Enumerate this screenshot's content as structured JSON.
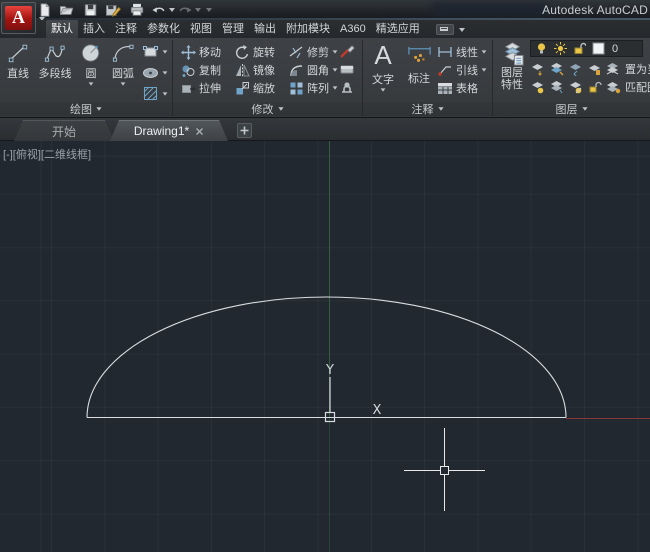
{
  "title_bar": {
    "app_title": "Autodesk AutoCAD"
  },
  "ribbon": {
    "tabs": [
      "默认",
      "插入",
      "注释",
      "参数化",
      "视图",
      "管理",
      "输出",
      "附加模块",
      "A360",
      "精选应用"
    ],
    "active_tab": "默认",
    "draw_panel": {
      "title": "绘图",
      "line": "直线",
      "polyline": "多段线",
      "circle": "圆",
      "arc": "圆弧"
    },
    "modify_panel": {
      "title": "修改",
      "move": "移动",
      "rotate": "旋转",
      "trim": "修剪",
      "copy": "复制",
      "mirror": "镜像",
      "fillet": "圆角",
      "stretch": "拉伸",
      "scale": "缩放",
      "array": "阵列"
    },
    "annotation_panel": {
      "title": "注释",
      "text": "文字",
      "text_icon": "A",
      "dimension": "标注",
      "linear": "线性",
      "leader": "引线",
      "table": "表格"
    },
    "layers_panel": {
      "title": "图层",
      "properties": "图层特性",
      "current_layer": "0",
      "set_current": "置为当前",
      "match_layer": "匹配图层"
    }
  },
  "file_tabs": {
    "start": "开始",
    "drawing": "Drawing1*"
  },
  "viewport": {
    "label": "[-][俯视][二维线框]",
    "ucs_x": "X",
    "ucs_y": "Y"
  },
  "colors": {
    "background": "#212830",
    "axis_x": "#8a3636",
    "axis_y": "#3b6b44",
    "line_white": "#d9dde0",
    "accent_blue": "#6fa3c8",
    "accent_yellow": "#e9c648",
    "logo_red": "#c0392b"
  }
}
